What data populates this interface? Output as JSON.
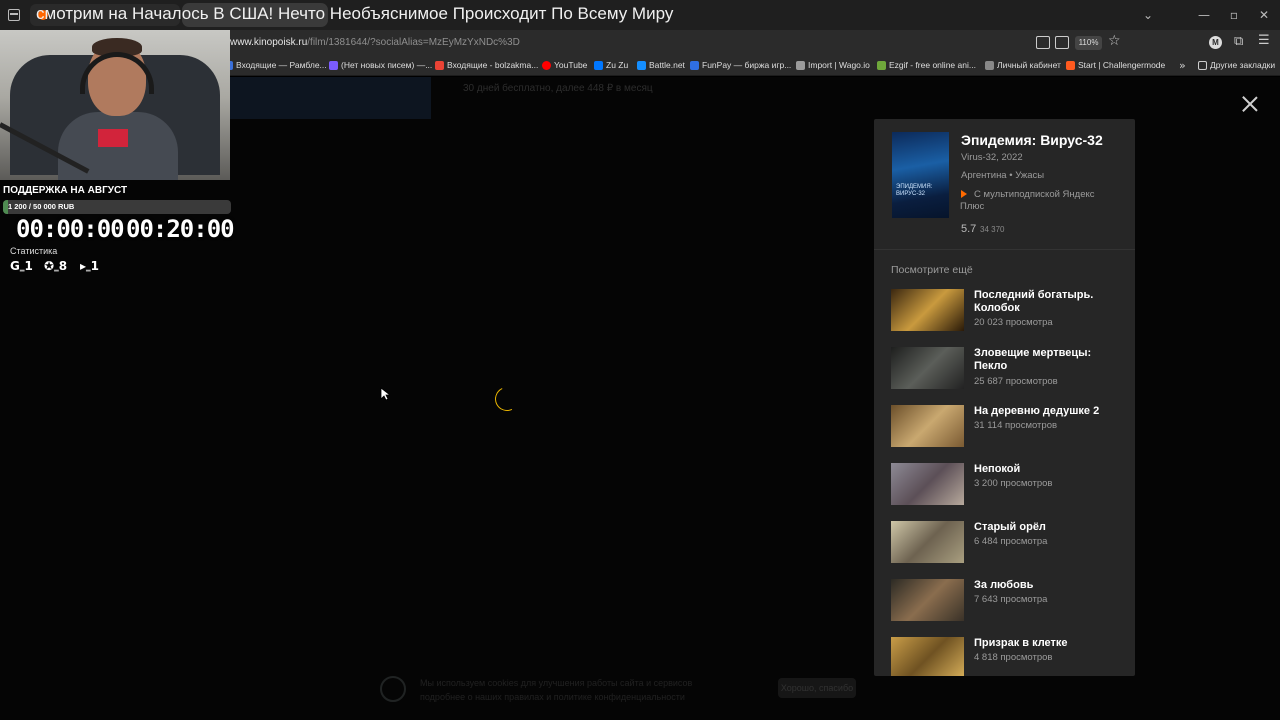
{
  "browser": {
    "stream_title": "смотрим на Началось В США! Нечто Необъяснимое Происходит По Всему Миру",
    "url_domain": "www.kinopoisk.ru",
    "url_path": "/film/1381644/?socialAlias=MzEyMzYxNDc%3D",
    "zoom": "110%",
    "profile_initial": "M",
    "window_controls": [
      "⌄",
      "—",
      "▫",
      "✕"
    ],
    "bookmarks": [
      {
        "label": "Входящие — Рамбле...",
        "color": "#3a6fd8"
      },
      {
        "label": "(Нет новых писем) —...",
        "color": "#7b5cff"
      },
      {
        "label": "Входящие - bolzakma...",
        "color": "#ea4335"
      },
      {
        "label": "YouTube",
        "color": "#ff0000"
      },
      {
        "label": "Zu Zu",
        "color": "#0077ff"
      },
      {
        "label": "Battle.net",
        "color": "#148eff"
      },
      {
        "label": "FunPay — биржа игр...",
        "color": "#2f6fe4"
      },
      {
        "label": "Import | Wago.io",
        "color": "#9b9b9b"
      },
      {
        "label": "Ezgif - free online ani...",
        "color": "#6fa83b"
      },
      {
        "label": "Личный кабинет",
        "color": "#888888"
      },
      {
        "label": "Start | Challengermode",
        "color": "#ff5a1f"
      }
    ],
    "other_bookmarks": "Другие закладки"
  },
  "page": {
    "promo_text": "30 дней бесплатно, далее 448 ₽ в месяц",
    "bottom_text_1": "Мы используем cookies для улучшения работы сайта и сервисов",
    "bottom_text_2": "подробнее о наших правилах и политике конфиденциальности",
    "bottom_button": "Хорошо, спасибо"
  },
  "film": {
    "title": "Эпидемия: Вирус-32",
    "subtitle": "Virus-32, 2022",
    "meta": "Аргентина • Ужасы",
    "subscription": "С мультиподпиской Яндекс Плюс",
    "rating": "5.7",
    "votes": "34 370",
    "poster_text": "ЭПИДЕМИЯ: ВИРУС-32"
  },
  "recommendations": {
    "title": "Посмотрите ещё",
    "items": [
      {
        "title": "Последний богатырь. Колобок",
        "views": "20 023 просмотра",
        "thumb": "#7a5a2a"
      },
      {
        "title": "Зловещие мертвецы: Пекло",
        "views": "25 687 просмотров",
        "thumb": "#3c3f3d"
      },
      {
        "title": "На деревню дедушке 2",
        "views": "31 114 просмотров",
        "thumb": "#a8864e"
      },
      {
        "title": "Непокой",
        "views": "3 200 просмотров",
        "thumb": "#6b5e66"
      },
      {
        "title": "Старый орёл",
        "views": "6 484 просмотра",
        "thumb": "#857a60"
      },
      {
        "title": "За любовь",
        "views": "7 643 просмотра",
        "thumb": "#5a4b3a"
      },
      {
        "title": "Призрак в клетке",
        "views": "4 818 просмотров",
        "thumb": "#a4813a"
      }
    ]
  },
  "overlay": {
    "support_title": "ПОДДЕРЖКА НА АВГУСТ",
    "support_amount": "1 200 / 50 000 RUB",
    "support_progress": 0.024,
    "timer_left": "00:00:00",
    "timer_right": "00:20:00",
    "stats_title": "Статистика",
    "stats": [
      {
        "icon": "G",
        "value": "1"
      },
      {
        "icon": "✪",
        "value": "8"
      },
      {
        "icon": "▸",
        "value": "1"
      }
    ]
  }
}
